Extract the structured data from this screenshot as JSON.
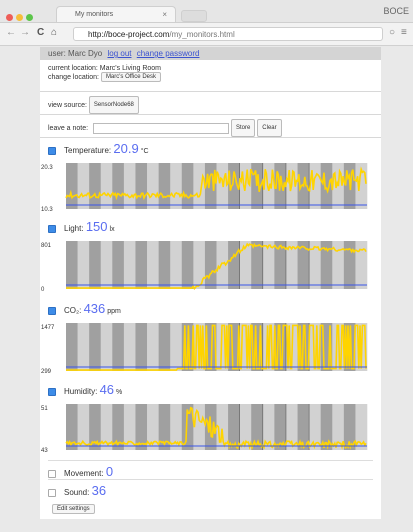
{
  "browser": {
    "tab_title": "My monitors",
    "tab_close": "×",
    "corner_label": "BOCE",
    "url_host": "http://boce-project.com",
    "url_path": "/my_monitors.html",
    "back": "←",
    "forward": "→",
    "reload": "C",
    "home": "⌂",
    "menu": "≡"
  },
  "user": {
    "prefix": "user: Marc Dyo",
    "logout": "log out",
    "change_password": "change password"
  },
  "location": {
    "current_label": "current location: Marc's Living Room",
    "change_label": "change location:",
    "change_button": "Marc's Office Desk"
  },
  "view_source": {
    "label": "view source:",
    "button": "SensorNode68"
  },
  "note": {
    "label": "leave a note:",
    "store": "Store",
    "clear": "Clear"
  },
  "sensors": {
    "temperature": {
      "label": "Temperature:",
      "value": "20.9",
      "unit": "°C",
      "ymax": "20.3",
      "ymin": "10.3"
    },
    "light": {
      "label": "Light:",
      "value": "150",
      "unit": "lx",
      "ymax": "801",
      "ymin": "0"
    },
    "co2": {
      "label": "CO₂:",
      "value": "436",
      "unit": "ppm",
      "ymax": "1477",
      "ymin": "299"
    },
    "humidity": {
      "label": "Humidity:",
      "value": "46",
      "unit": "%",
      "ymax": "51",
      "ymin": "43"
    },
    "movement": {
      "label": "Movement:",
      "value": "0"
    },
    "sound": {
      "label": "Sound:",
      "value": "36"
    }
  },
  "edit_settings": "Edit settings",
  "colors": {
    "accent": "#5a6df0",
    "series": "#ffd400",
    "baseline": "#3a55e8",
    "band_dark": "#a0a0a0",
    "band_light": "#d2d2d2"
  }
}
